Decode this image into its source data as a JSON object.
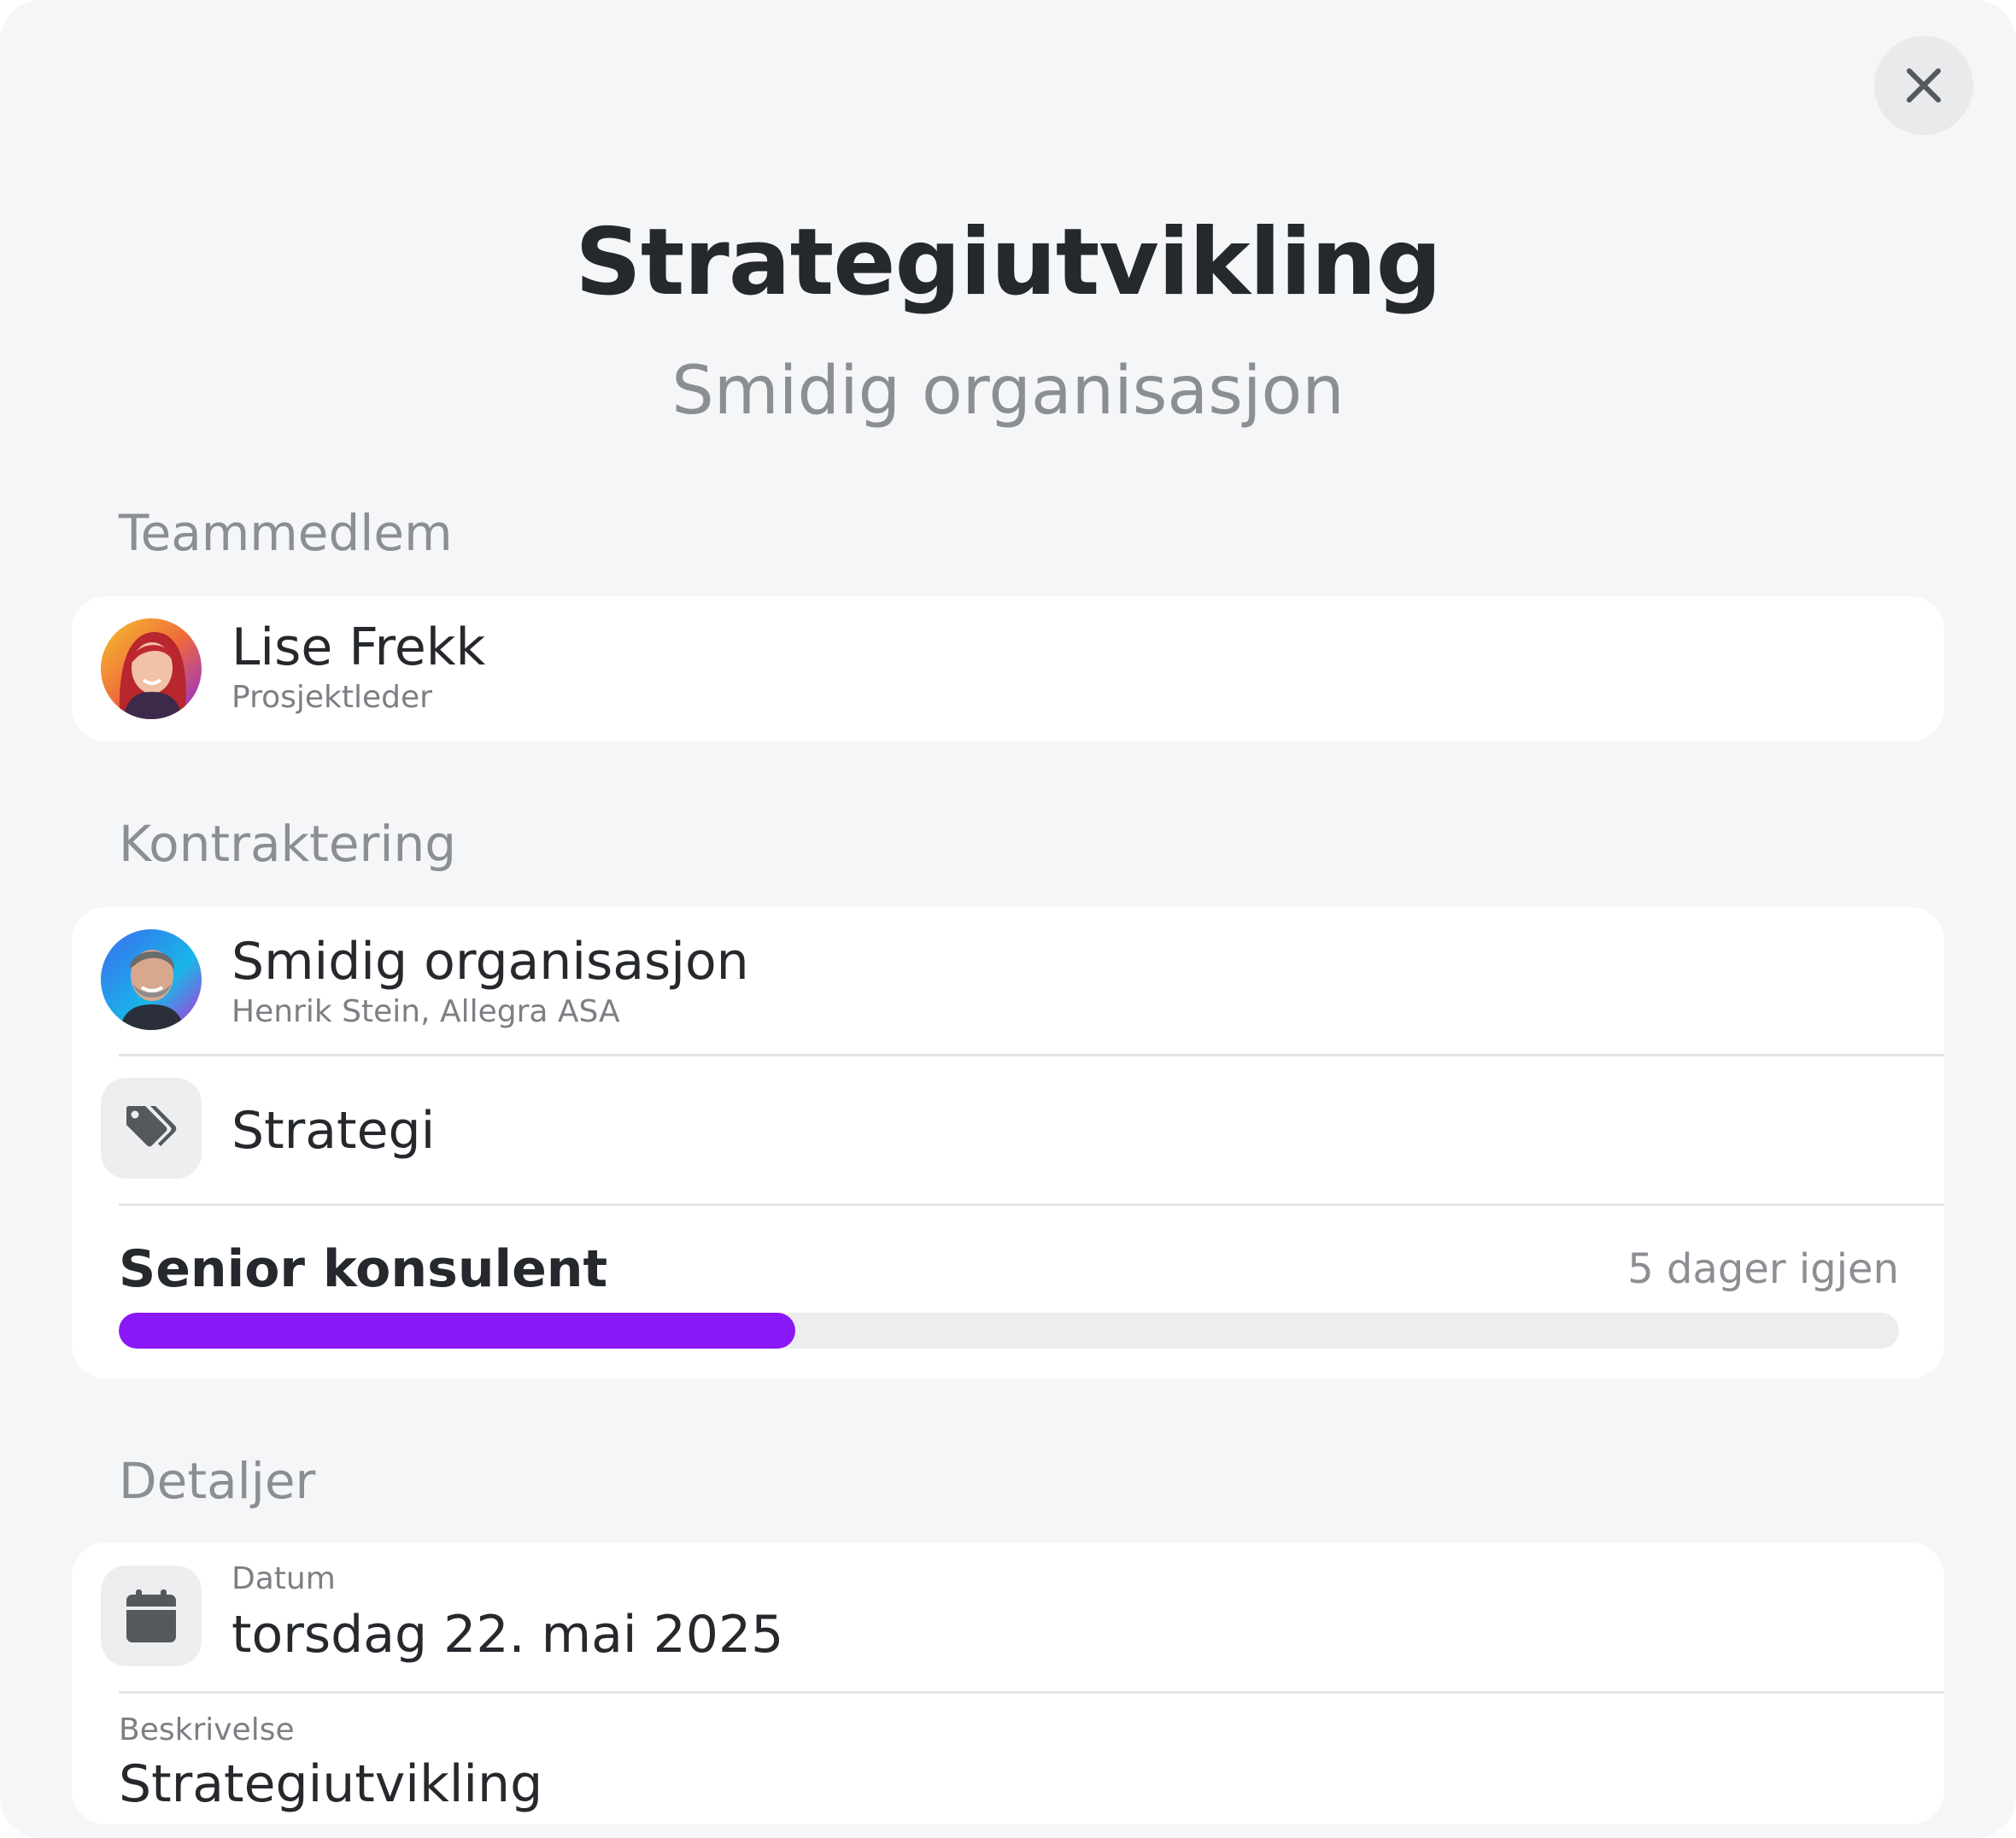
{
  "header": {
    "title": "Strategiutvikling",
    "subtitle": "Smidig organisasjon",
    "close_icon": "close-icon"
  },
  "team": {
    "section_label": "Teammedlem",
    "member": {
      "name": "Lise Frekk",
      "role": "Prosjektleder"
    }
  },
  "contract": {
    "section_label": "Kontraktering",
    "client": {
      "name": "Smidig organisasjon",
      "contact": "Henrik Stein, Allegra ASA"
    },
    "category": {
      "icon": "tag-icon",
      "label": "Strategi"
    },
    "role": {
      "title": "Senior konsulent",
      "remaining": "5 dager igjen",
      "progress_fraction": 0.38,
      "progress_color": "#8A17F5"
    }
  },
  "details": {
    "section_label": "Detaljer",
    "date": {
      "icon": "calendar-icon",
      "label": "Datum",
      "value": "torsdag 22. mai 2025"
    },
    "description": {
      "label": "Beskrivelse",
      "value": "Strategiutvikling"
    }
  }
}
